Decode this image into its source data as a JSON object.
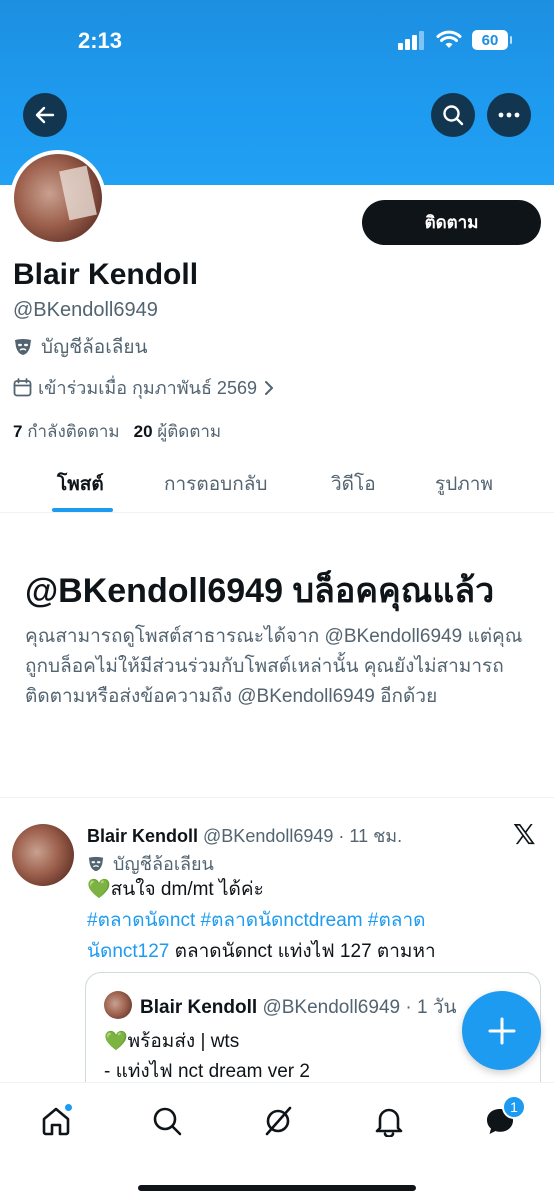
{
  "status_bar": {
    "time": "2:13",
    "battery": "60"
  },
  "profile": {
    "follow_label": "ติดตาม",
    "display_name": "Blair Kendoll",
    "handle": "@BKendoll6949",
    "parody_label": "บัญชีล้อเลียน",
    "joined": "เข้าร่วมเมื่อ กุมภาพันธ์ 2569",
    "following_count": "7",
    "following_label": "กำลังติดตาม",
    "followers_count": "20",
    "followers_label": "ผู้ติดตาม"
  },
  "tabs": [
    {
      "label": "โพสต์"
    },
    {
      "label": "การตอบกลับ"
    },
    {
      "label": "วิดีโอ"
    },
    {
      "label": "รูปภาพ"
    }
  ],
  "blocked": {
    "title": "@BKendoll6949 บล็อคคุณแล้ว",
    "description": "คุณสามารถดูโพสต์สาธารณะได้จาก @BKendoll6949 แต่คุณถูกบล็อคไม่ให้มีส่วนร่วมกับโพสต์เหล่านั้น คุณยังไม่สามารถติดตามหรือส่งข้อความถึง @BKendoll6949 อีกด้วย"
  },
  "tweet": {
    "name": "Blair Kendoll",
    "meta": "@BKendoll6949 · 11 ชม.",
    "parody_label": "บัญชีล้อเลียน",
    "line1": "💚สนใจ dm/mt ได้ค่ะ",
    "tag1": "#ตลาดนัดnct",
    "tag2": "#ตลาดนัดnctdream",
    "tag3": "#ตลาดนัดnct127",
    "tail": " ตลาดนัดnct แท่งไฟ 127 ตามหา",
    "quote": {
      "name": "Blair Kendoll",
      "meta": "@BKendoll6949 · 1 วัน",
      "line1": "💚พร้อมส่ง | wts",
      "line2": "- แท่งไฟ nct dream ver 2"
    }
  },
  "nav": {
    "messages_badge": "1"
  },
  "colors": {
    "accent": "#1d9bf0",
    "text": "#0f1419",
    "muted": "#536471"
  }
}
